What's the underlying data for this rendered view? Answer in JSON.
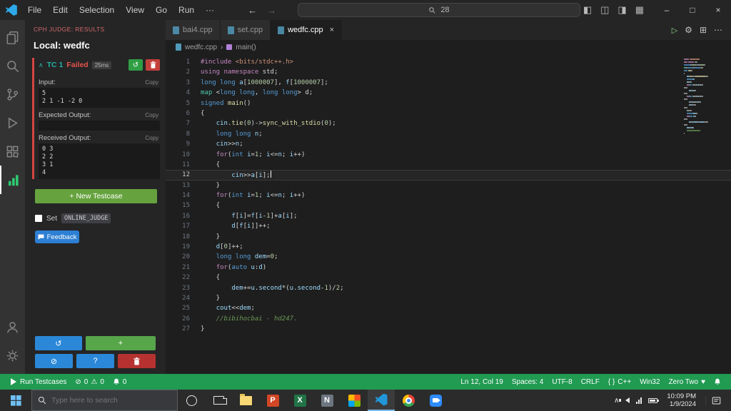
{
  "colors": {
    "statusbar": "#219a52",
    "failed": "#e5534b",
    "testcase_accent": "#23b1a4",
    "cph_header": "#d16969"
  },
  "app": {
    "menus": [
      "File",
      "Edit",
      "Selection",
      "View",
      "Go",
      "Run",
      "···"
    ],
    "command_center_text": "28",
    "back_arrow": "←",
    "forward_arrow": "→",
    "minimize": "–",
    "restore": "□",
    "close": "×",
    "layout_icons": [
      "◧",
      "◫",
      "◨",
      "▦"
    ]
  },
  "activity_bar": {
    "items": [
      {
        "name": "explorer",
        "active": false
      },
      {
        "name": "search",
        "active": false
      },
      {
        "name": "source-control",
        "active": false
      },
      {
        "name": "run-debug",
        "active": false
      },
      {
        "name": "extensions",
        "active": false
      },
      {
        "name": "cph-judge",
        "active": true
      }
    ],
    "bottom": [
      {
        "name": "account",
        "active": false
      },
      {
        "name": "settings",
        "active": false
      }
    ]
  },
  "sidebar": {
    "header": "CPH JUDGE: RESULTS",
    "title": "Local: wedfc",
    "testcase": {
      "chevron": "∧",
      "name": "TC 1",
      "status": "Failed",
      "time": "25ms",
      "sections": [
        {
          "label": "Input:",
          "copy": "Copy",
          "content": [
            "5",
            "2 1 -1 -2 0"
          ]
        },
        {
          "label": "Expected Output:",
          "copy": "Copy",
          "content": []
        },
        {
          "label": "Received Output:",
          "copy": "Copy",
          "content": [
            "0 3",
            "2 2",
            "3 1",
            "4"
          ]
        }
      ]
    },
    "new_testcase_label": "+ New Testcase",
    "set_label": "Set",
    "online_judge_label": "ONLINE_JUDGE",
    "feedback_label": "Feedback",
    "bottom_buttons": [
      {
        "name": "rerun-all",
        "glyph": "↺",
        "color": "blue",
        "row": 1,
        "grow": 2
      },
      {
        "name": "add-testcase",
        "glyph": "+",
        "color": "green",
        "row": 1,
        "grow": 3
      },
      {
        "name": "stop",
        "glyph": "⊘",
        "color": "blue",
        "row": 2,
        "grow": 1
      },
      {
        "name": "help",
        "glyph": "?",
        "color": "blue",
        "row": 2,
        "grow": 1
      },
      {
        "name": "delete-all",
        "glyph": "trash",
        "color": "red",
        "row": 2,
        "grow": 1
      }
    ]
  },
  "editor": {
    "tabs": [
      {
        "label": "bai4.cpp",
        "active": false
      },
      {
        "label": "set.cpp",
        "active": false
      },
      {
        "label": "wedfc.cpp",
        "active": true,
        "close": "×"
      }
    ],
    "actions": {
      "run": "▷",
      "gear": "⚙",
      "split": "⊞",
      "more": "⋯"
    },
    "breadcrumb": {
      "file": "wedfc.cpp",
      "sep": "›",
      "symbol": "main()"
    },
    "current_line": 12,
    "lines": [
      [
        [
          "#include",
          "k"
        ],
        [
          " ",
          "p"
        ],
        [
          "<bits/stdc++.h>",
          "s"
        ]
      ],
      [
        [
          "using",
          "k"
        ],
        [
          " ",
          "p"
        ],
        [
          "namespace",
          "k"
        ],
        [
          " ",
          "p"
        ],
        [
          "std",
          "p"
        ],
        [
          ";",
          "p"
        ]
      ],
      [
        [
          "long long ",
          "t"
        ],
        [
          "a",
          "v"
        ],
        [
          "[",
          "p"
        ],
        [
          "1000007",
          "n"
        ],
        [
          "], ",
          "p"
        ],
        [
          "f",
          "v"
        ],
        [
          "[",
          "p"
        ],
        [
          "1000007",
          "n"
        ],
        [
          "];",
          "p"
        ]
      ],
      [
        [
          "map",
          "m"
        ],
        [
          " <",
          "p"
        ],
        [
          "long long",
          "t"
        ],
        [
          ", ",
          "p"
        ],
        [
          "long long",
          "t"
        ],
        [
          "> ",
          "p"
        ],
        [
          "d",
          "p"
        ],
        [
          ";",
          "p"
        ]
      ],
      [
        [
          "signed",
          "t"
        ],
        [
          " ",
          "p"
        ],
        [
          "main",
          "f"
        ],
        [
          "()",
          "p"
        ]
      ],
      [
        [
          "{",
          "p"
        ]
      ],
      [
        [
          "    ",
          "p"
        ],
        [
          "cin",
          "v"
        ],
        [
          ".",
          "p"
        ],
        [
          "tie",
          "f"
        ],
        [
          "(",
          "p"
        ],
        [
          "0",
          "n"
        ],
        [
          ")->",
          "p"
        ],
        [
          "sync_with_stdio",
          "f"
        ],
        [
          "(",
          "p"
        ],
        [
          "0",
          "n"
        ],
        [
          ");",
          "p"
        ]
      ],
      [
        [
          "    ",
          "p"
        ],
        [
          "long long ",
          "t"
        ],
        [
          "n",
          "v"
        ],
        [
          ";",
          "p"
        ]
      ],
      [
        [
          "    ",
          "p"
        ],
        [
          "cin",
          "v"
        ],
        [
          ">>",
          "p"
        ],
        [
          "n",
          "v"
        ],
        [
          ";",
          "p"
        ]
      ],
      [
        [
          "    ",
          "p"
        ],
        [
          "for",
          "k"
        ],
        [
          "(",
          "p"
        ],
        [
          "int",
          "t"
        ],
        [
          " ",
          "p"
        ],
        [
          "i",
          "v"
        ],
        [
          "=",
          "p"
        ],
        [
          "1",
          "n"
        ],
        [
          "; ",
          "p"
        ],
        [
          "i",
          "v"
        ],
        [
          "<=",
          "p"
        ],
        [
          "n",
          "v"
        ],
        [
          "; ",
          "p"
        ],
        [
          "i",
          "v"
        ],
        [
          "++)",
          "p"
        ]
      ],
      [
        [
          "    {",
          "p"
        ]
      ],
      [
        [
          "        ",
          "p"
        ],
        [
          "cin",
          "v"
        ],
        [
          ">>",
          "p"
        ],
        [
          "a",
          "v"
        ],
        [
          "[",
          "p"
        ],
        [
          "i",
          "v"
        ],
        [
          "];",
          "p"
        ]
      ],
      [
        [
          "    }",
          "p"
        ]
      ],
      [
        [
          "    ",
          "p"
        ],
        [
          "for",
          "k"
        ],
        [
          "(",
          "p"
        ],
        [
          "int",
          "t"
        ],
        [
          " ",
          "p"
        ],
        [
          "i",
          "v"
        ],
        [
          "=",
          "p"
        ],
        [
          "1",
          "n"
        ],
        [
          "; ",
          "p"
        ],
        [
          "i",
          "v"
        ],
        [
          "<=",
          "p"
        ],
        [
          "n",
          "v"
        ],
        [
          "; ",
          "p"
        ],
        [
          "i",
          "v"
        ],
        [
          "++)",
          "p"
        ]
      ],
      [
        [
          "    {",
          "p"
        ]
      ],
      [
        [
          "        ",
          "p"
        ],
        [
          "f",
          "v"
        ],
        [
          "[",
          "p"
        ],
        [
          "i",
          "v"
        ],
        [
          "]=",
          "p"
        ],
        [
          "f",
          "v"
        ],
        [
          "[",
          "p"
        ],
        [
          "i",
          "v"
        ],
        [
          "-",
          "p"
        ],
        [
          "1",
          "n"
        ],
        [
          "]+",
          "p"
        ],
        [
          "a",
          "v"
        ],
        [
          "[",
          "p"
        ],
        [
          "i",
          "v"
        ],
        [
          "];",
          "p"
        ]
      ],
      [
        [
          "        ",
          "p"
        ],
        [
          "d",
          "v"
        ],
        [
          "[",
          "p"
        ],
        [
          "f",
          "v"
        ],
        [
          "[",
          "p"
        ],
        [
          "i",
          "v"
        ],
        [
          "]]++;",
          "p"
        ]
      ],
      [
        [
          "    }",
          "p"
        ]
      ],
      [
        [
          "    ",
          "p"
        ],
        [
          "d",
          "v"
        ],
        [
          "[",
          "p"
        ],
        [
          "0",
          "n"
        ],
        [
          "]++;",
          "p"
        ]
      ],
      [
        [
          "    ",
          "p"
        ],
        [
          "long long ",
          "t"
        ],
        [
          "dem",
          "v"
        ],
        [
          "=",
          "p"
        ],
        [
          "0",
          "n"
        ],
        [
          ";",
          "p"
        ]
      ],
      [
        [
          "    ",
          "p"
        ],
        [
          "for",
          "k"
        ],
        [
          "(",
          "p"
        ],
        [
          "auto",
          "t"
        ],
        [
          " ",
          "p"
        ],
        [
          "u",
          "v"
        ],
        [
          ":",
          "p"
        ],
        [
          "d",
          "v"
        ],
        [
          ")",
          "p"
        ]
      ],
      [
        [
          "    {",
          "p"
        ]
      ],
      [
        [
          "        ",
          "p"
        ],
        [
          "dem",
          "v"
        ],
        [
          "+=",
          "p"
        ],
        [
          "u",
          "v"
        ],
        [
          ".",
          "p"
        ],
        [
          "second",
          "v"
        ],
        [
          "*(",
          "p"
        ],
        [
          "u",
          "v"
        ],
        [
          ".",
          "p"
        ],
        [
          "second",
          "v"
        ],
        [
          "-",
          "p"
        ],
        [
          "1",
          "n"
        ],
        [
          ")/",
          "p"
        ],
        [
          "2",
          "n"
        ],
        [
          ";",
          "p"
        ]
      ],
      [
        [
          "    }",
          "p"
        ]
      ],
      [
        [
          "    ",
          "p"
        ],
        [
          "cout",
          "v"
        ],
        [
          "<<",
          "p"
        ],
        [
          "dem",
          "v"
        ],
        [
          ";",
          "p"
        ]
      ],
      [
        [
          "    ",
          "p"
        ],
        [
          "//bibihocbai - hd247.",
          "c"
        ]
      ],
      [
        [
          "}",
          "p"
        ]
      ]
    ]
  },
  "status_bar": {
    "run_label": "Run Testcases",
    "errors_icon": "⊘",
    "errors": "0",
    "warnings_icon": "⚠",
    "warnings": "0",
    "bell_count": "0",
    "cursor": "Ln 12, Col 19",
    "indent": "Spaces: 4",
    "encoding": "UTF-8",
    "eol": "CRLF",
    "braces": "{ }",
    "language": "C++",
    "platform": "Win32",
    "theme": "Zero Two",
    "heart": "♥"
  },
  "taskbar": {
    "search_placeholder": "Type here to search",
    "apps": [
      {
        "name": "cortana"
      },
      {
        "name": "task-view"
      },
      {
        "name": "file-explorer"
      },
      {
        "name": "powerpoint",
        "letter": "P",
        "color": "#d24726"
      },
      {
        "name": "excel",
        "letter": "X",
        "color": "#217346"
      },
      {
        "name": "notepad",
        "letter": "N",
        "color": "#6d7680"
      },
      {
        "name": "photos"
      },
      {
        "name": "vscode",
        "active": true
      },
      {
        "name": "chrome"
      },
      {
        "name": "zoom"
      }
    ],
    "tray_chevron": "∧",
    "clock": {
      "time": "10:09 PM",
      "date": "1/9/2024"
    }
  }
}
